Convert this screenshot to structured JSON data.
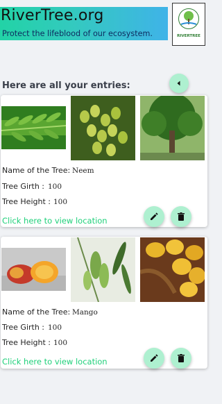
{
  "brand": {
    "title": "RiverTree.org",
    "tagline": "Protect the lifeblood of our ecosystem.",
    "logo_text": "RIVERTREE"
  },
  "list_heading": "Here are all your entries:",
  "labels": {
    "name": "Name of the Tree:",
    "girth": "Tree Girth :",
    "height": "Tree Height :",
    "location_link": "Click here to view location"
  },
  "entries": [
    {
      "name": "Neem",
      "girth": "100",
      "height": "100"
    },
    {
      "name": "Mango",
      "girth": "100",
      "height": "100"
    }
  ],
  "colors": {
    "accent_green": "#1fd07a",
    "button_bg": "#aef0d0",
    "banner_start": "#22d3a6",
    "banner_end": "#3fb3e8"
  },
  "icons": {
    "back": "chevron-left-icon",
    "edit": "pencil-icon",
    "delete": "trash-icon"
  }
}
